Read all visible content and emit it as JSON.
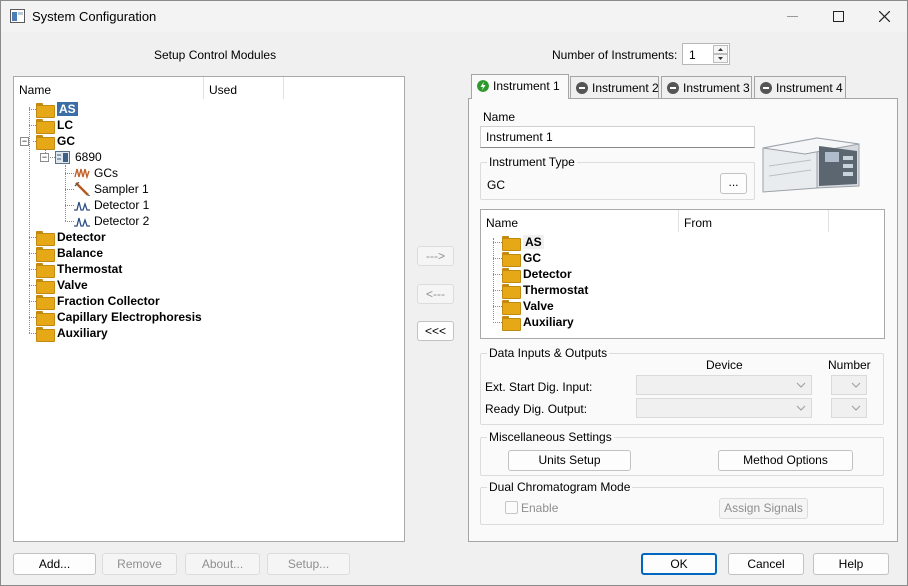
{
  "window": {
    "title": "System Configuration",
    "minimize_glyph": "—",
    "maximize_glyph": "☐",
    "close_glyph": "✕"
  },
  "left": {
    "title": "Setup Control Modules",
    "columns": [
      "Name",
      "Used"
    ],
    "tree": {
      "as": "AS",
      "lc": "LC",
      "gc": "GC",
      "gc6890": "6890",
      "gcs": "GCs",
      "sampler1": "Sampler 1",
      "detector1": "Detector 1",
      "detector2": "Detector 2",
      "detector": "Detector",
      "balance": "Balance",
      "thermostat": "Thermostat",
      "valve": "Valve",
      "fraction": "Fraction Collector",
      "ce": "Capillary Electrophoresis",
      "auxiliary": "Auxiliary"
    }
  },
  "middle": {
    "add_arrow": "--->",
    "remove_arrow": "<---",
    "remove_all": "<<<"
  },
  "instruments": {
    "count_label": "Number of Instruments:",
    "count_value": "1",
    "tabs": [
      "Instrument 1",
      "Instrument 2",
      "Instrument 3",
      "Instrument 4"
    ],
    "name_label": "Name",
    "name_value": "Instrument 1",
    "type_group": "Instrument Type",
    "type_value": "GC",
    "type_button": "...",
    "columns": [
      "Name",
      "From"
    ],
    "modules": {
      "as": "AS",
      "gc": "GC",
      "detector": "Detector",
      "thermostat": "Thermostat",
      "valve": "Valve",
      "auxiliary": "Auxiliary"
    },
    "dio": {
      "group": "Data Inputs & Outputs",
      "device_header": "Device",
      "number_header": "Number",
      "ext_start": "Ext. Start Dig. Input:",
      "ready": "Ready Dig. Output:"
    },
    "misc": {
      "group": "Miscellaneous Settings",
      "units": "Units Setup",
      "method": "Method Options"
    },
    "dual": {
      "group": "Dual Chromatogram Mode",
      "enable": "Enable",
      "assign": "Assign Signals"
    }
  },
  "footer": {
    "add": "Add...",
    "remove": "Remove",
    "about": "About...",
    "setup": "Setup...",
    "ok": "OK",
    "cancel": "Cancel",
    "help": "Help"
  },
  "colors": {
    "selection": "#3a6ea5",
    "folder": "#e6a817",
    "accent": "#0067c0",
    "active_tab_icon": "#2e9a2e"
  }
}
